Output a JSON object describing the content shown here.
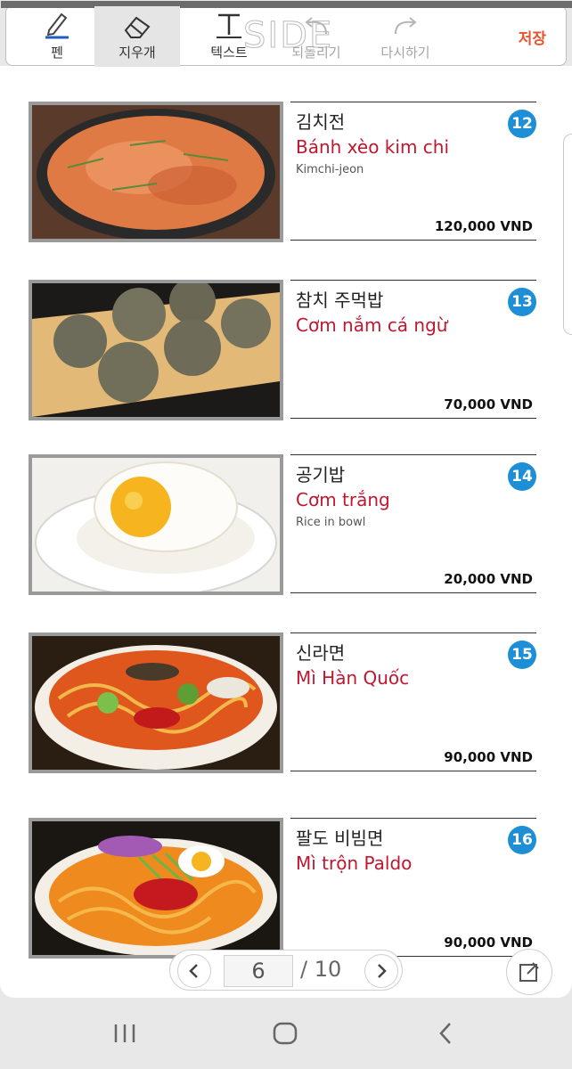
{
  "toolbar": {
    "pen": "펜",
    "eraser": "지우개",
    "text": "텍스트",
    "undo": "되돌리기",
    "redo": "다시하기",
    "save": "저장",
    "watermark": "SIDE"
  },
  "menu": {
    "items": [
      {
        "number": "12",
        "korean": "김치전",
        "vietnamese": "Bánh xèo kim chi",
        "english": "Kimchi-jeon",
        "price": "120,000 VND"
      },
      {
        "number": "13",
        "korean": "참치 주먹밥",
        "vietnamese": "Cơm nắm cá ngừ",
        "english": "",
        "price": "70,000 VND"
      },
      {
        "number": "14",
        "korean": "공기밥",
        "vietnamese": "Cơm trắng",
        "english": "Rice in bowl",
        "price": "20,000 VND"
      },
      {
        "number": "15",
        "korean": "신라면",
        "vietnamese": "Mì Hàn Quốc",
        "english": "",
        "price": "90,000 VND"
      },
      {
        "number": "16",
        "korean": "팔도 비빔면",
        "vietnamese": "Mì trộn Paldo",
        "english": "",
        "price": "90,000 VND"
      }
    ]
  },
  "pager": {
    "current_page": "6",
    "total": "/ 10"
  },
  "colors": {
    "accent_save": "#e8532e",
    "vietnamese_text": "#c0172f",
    "number_badge": "#1e8fd6"
  }
}
